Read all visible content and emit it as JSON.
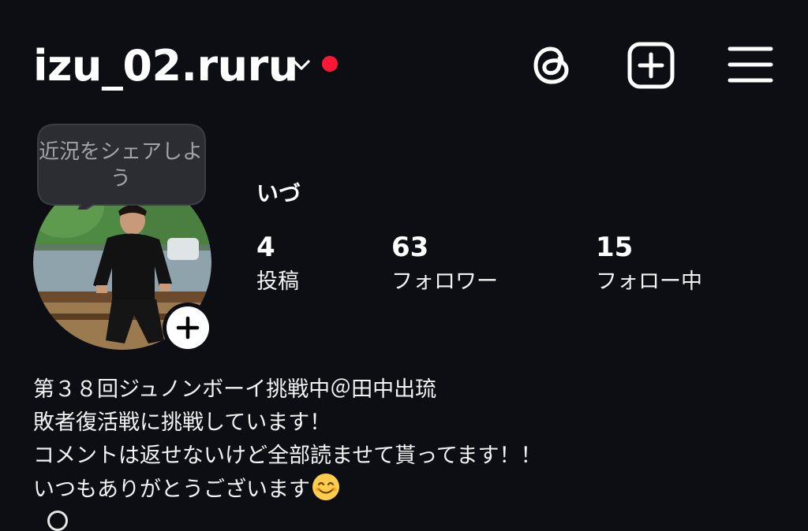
{
  "header": {
    "username": "izu_02.ruru",
    "icons": [
      "chevron-down-icon",
      "notification-dot",
      "threads-icon",
      "new-post-icon",
      "menu-icon"
    ],
    "accent_color": "#ff1736"
  },
  "note_bubble": {
    "text": "近況をシェアしよう"
  },
  "profile": {
    "display_name": "いづ",
    "stats": [
      {
        "value": "4",
        "label": "投稿"
      },
      {
        "value": "63",
        "label": "フォロワー"
      },
      {
        "value": "15",
        "label": "フォロー中"
      }
    ]
  },
  "bio": {
    "lines": [
      "第３８回ジュノンボーイ挑戦中＠田中出琉",
      "敗者復活戦に挑戦しています！",
      "コメントは返せないけど全部読ませて貰ってます！！",
      "いつもありがとうございます"
    ],
    "emoji": "smiling-face-emoji"
  }
}
